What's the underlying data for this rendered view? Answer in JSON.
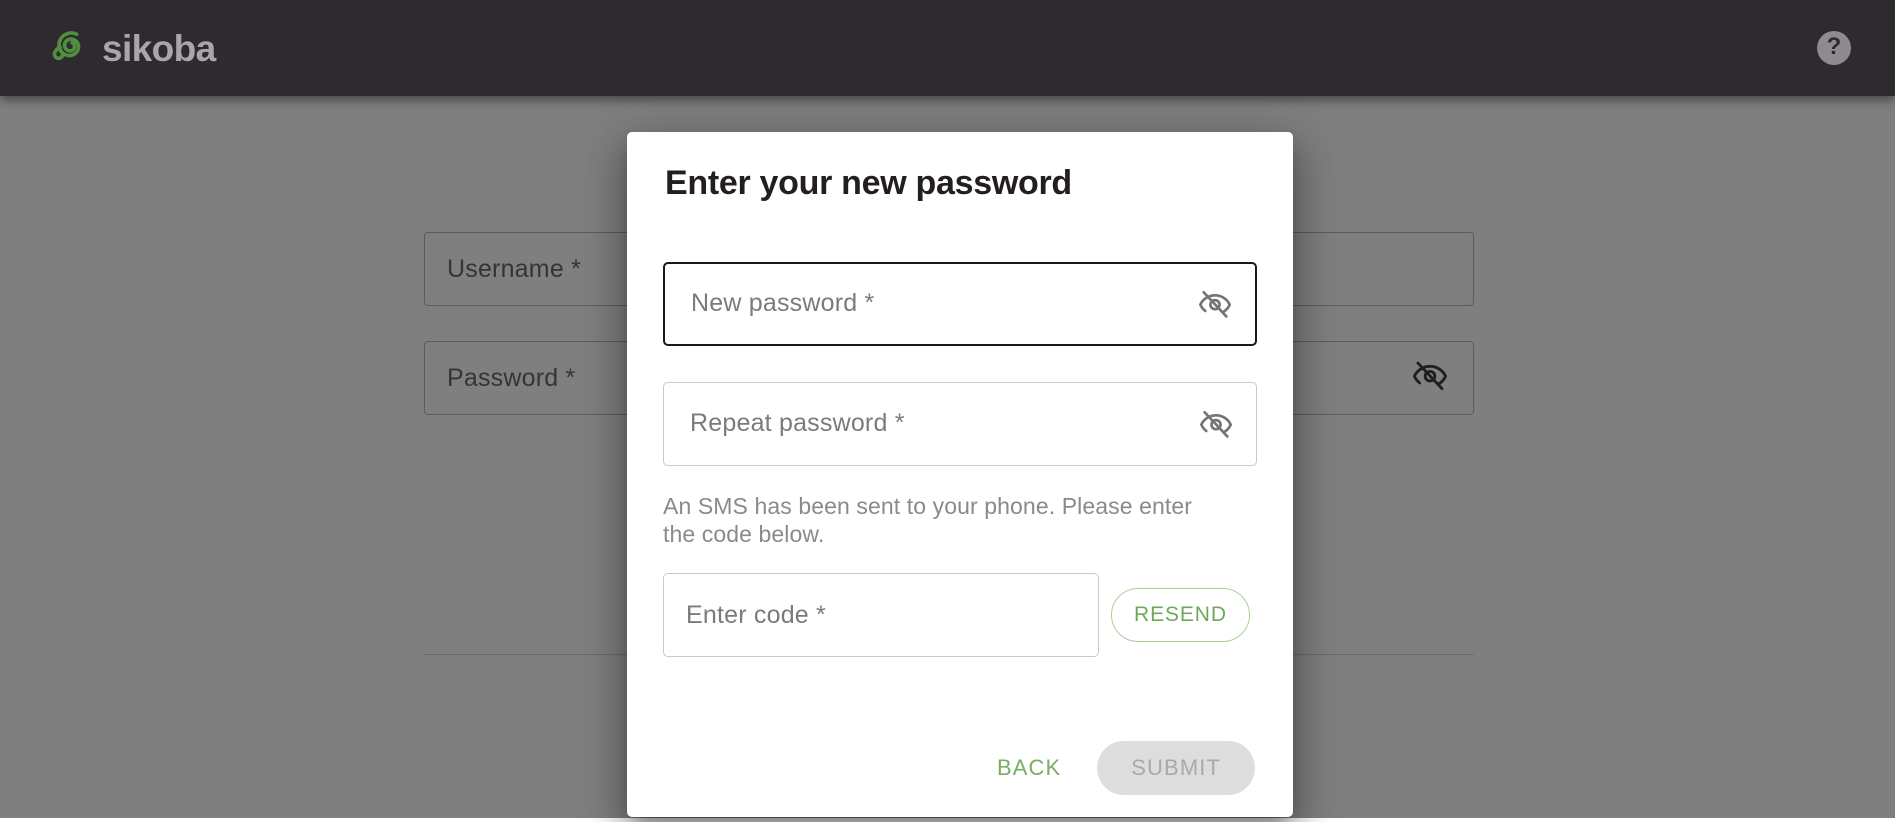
{
  "header": {
    "brand_name": "sikoba",
    "logo_icon": "sikoba-spiral-logo",
    "help_icon": "help-question-icon",
    "help_label": "?",
    "bg_color": "#2e2a30",
    "brand_text_color": "#a8a6a9",
    "logo_color": "#4f8f3d"
  },
  "background_form": {
    "fields": [
      {
        "label": "Username *",
        "icon": null
      },
      {
        "label": "Password *",
        "icon": "eye-off-icon"
      }
    ]
  },
  "dialog": {
    "title": "Enter your new password",
    "fields": [
      {
        "placeholder": "New password *",
        "icon": "eye-off-icon",
        "focused": true
      },
      {
        "placeholder": "Repeat password *",
        "icon": "eye-off-icon",
        "focused": false
      }
    ],
    "sms_note": "An SMS has been sent to your phone. Please enter the code below.",
    "code_field": {
      "placeholder": "Enter code *"
    },
    "resend_label": "RESEND",
    "back_label": "BACK",
    "submit_label": "SUBMIT",
    "submit_disabled": true
  },
  "colors": {
    "accent_green": "#7aae63",
    "resend_border": "#a9cf9b",
    "disabled_bg": "#dddddd",
    "disabled_text": "#a9a9a9",
    "scrim": "rgba(0,0,0,0.50)"
  }
}
